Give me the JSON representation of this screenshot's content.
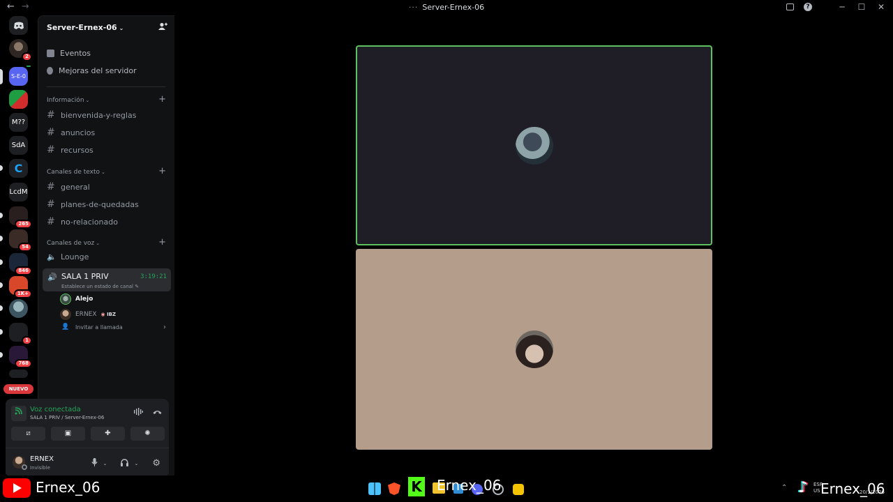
{
  "window": {
    "title": "Server-Ernex-06",
    "nav_back": "←",
    "nav_forward": "→",
    "title_dots": "···",
    "help": "?",
    "minimize": "─",
    "maximize": "☐",
    "close": "✕"
  },
  "servers": [
    {
      "label": "",
      "badge": "2"
    },
    {
      "label": "S-E-0",
      "badge": ""
    },
    {
      "label": "",
      "badge": ""
    },
    {
      "label": "M??",
      "badge": ""
    },
    {
      "label": "SdA",
      "badge": ""
    },
    {
      "label": "",
      "badge": ""
    },
    {
      "label": "LcdM",
      "badge": ""
    },
    {
      "label": "",
      "badge": "265"
    },
    {
      "label": "",
      "badge": "54"
    },
    {
      "label": "",
      "badge": "846"
    },
    {
      "label": "",
      "badge": "1K+"
    },
    {
      "label": "",
      "badge": ""
    },
    {
      "label": "",
      "badge": "1"
    },
    {
      "label": "",
      "badge": "768"
    }
  ],
  "nuevo_label": "NUEVO",
  "server": {
    "name": "Server-Ernex-06",
    "top_items": [
      "Eventos",
      "Mejoras del servidor"
    ]
  },
  "categories": {
    "info": "Información",
    "text": "Canales de texto",
    "voice": "Canales de voz"
  },
  "channels": {
    "info": [
      "bienvenida-y-reglas",
      "anuncios",
      "recursos"
    ],
    "text": [
      "general",
      "planes-de-quedadas",
      "no-relacionado"
    ],
    "voice_lounge": "Lounge"
  },
  "active_voice": {
    "name": "SALA 1 PRIV",
    "timer": "3:19:21",
    "status_prompt": "Establece un estado de canal",
    "members": [
      {
        "name": "Alejo",
        "tag": ""
      },
      {
        "name": "ERNEX",
        "tag": "IBZ"
      }
    ],
    "invite": "Invitar a llamada"
  },
  "voice_panel": {
    "title": "Voz conectada",
    "subtitle": "SALA 1 PRIV / Server-Ernex-06"
  },
  "user": {
    "name": "ERNEX",
    "status": "Invisible"
  },
  "overlay": {
    "youtube_name": "Ernex_06",
    "kick_name": "Ernex_06",
    "tiktok_name": "Ernex_06",
    "lang_1": "ESP",
    "lang_2": "US",
    "date": "20/1/2026"
  },
  "colors": {
    "accent_green": "#23a559",
    "speaking_border": "#5ec160",
    "tile2_bg": "#b49e8b",
    "badge_red": "#f23f43"
  }
}
